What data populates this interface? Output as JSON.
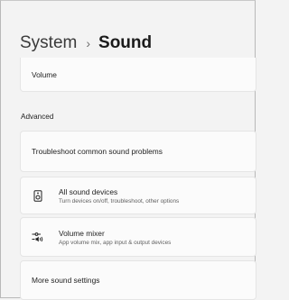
{
  "header": {
    "parent_label": "System",
    "separator": "›",
    "current_label": "Sound"
  },
  "volume": {
    "label": "Volume"
  },
  "advanced": {
    "heading": "Advanced",
    "items": [
      {
        "label": "Troubleshoot common sound problems"
      },
      {
        "label": "All sound devices",
        "description": "Turn devices on/off, troubleshoot, other options",
        "icon": "speaker-device-icon"
      },
      {
        "label": "Volume mixer",
        "description": "App volume mix, app input & output devices",
        "icon": "volume-mixer-icon"
      },
      {
        "label": "More sound settings"
      }
    ]
  }
}
